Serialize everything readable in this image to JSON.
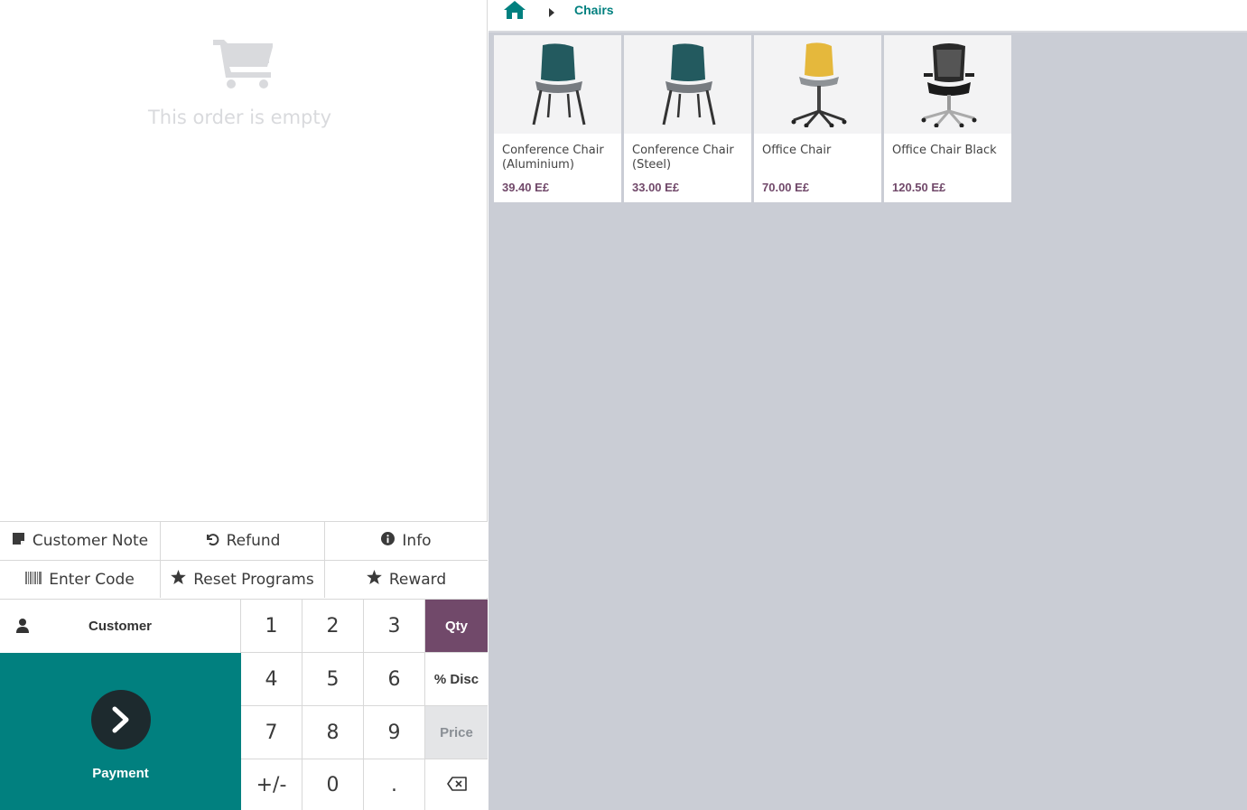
{
  "order": {
    "empty_text": "This order is empty"
  },
  "controls": {
    "customer_note": "Customer Note",
    "refund": "Refund",
    "info": "Info",
    "enter_code": "Enter Code",
    "reset_programs": "Reset Programs",
    "reward": "Reward"
  },
  "customer_label": "Customer",
  "payment_label": "Payment",
  "numpad": {
    "k1": "1",
    "k2": "2",
    "k3": "3",
    "qty": "Qty",
    "k4": "4",
    "k5": "5",
    "k6": "6",
    "disc": "% Disc",
    "k7": "7",
    "k8": "8",
    "k9": "9",
    "price": "Price",
    "sign": "+/-",
    "k0": "0",
    "dot": "."
  },
  "breadcrumb": {
    "category": "Chairs"
  },
  "products": [
    {
      "name": "Conference Chair (Aluminium)",
      "price": "39.40 E£"
    },
    {
      "name": "Conference Chair (Steel)",
      "price": "33.00 E£"
    },
    {
      "name": "Office Chair",
      "price": "70.00 E£"
    },
    {
      "name": "Office Chair Black",
      "price": "120.50 E£"
    }
  ],
  "colors": {
    "teal": "#01807f",
    "purple": "#71496a",
    "background": "#cacdd5"
  },
  "icons": [
    "cart-icon",
    "note-icon",
    "undo-icon",
    "info-icon",
    "barcode-icon",
    "star-icon",
    "user-icon",
    "chevron-right-icon",
    "backspace-icon",
    "home-icon",
    "caret-right-icon"
  ]
}
